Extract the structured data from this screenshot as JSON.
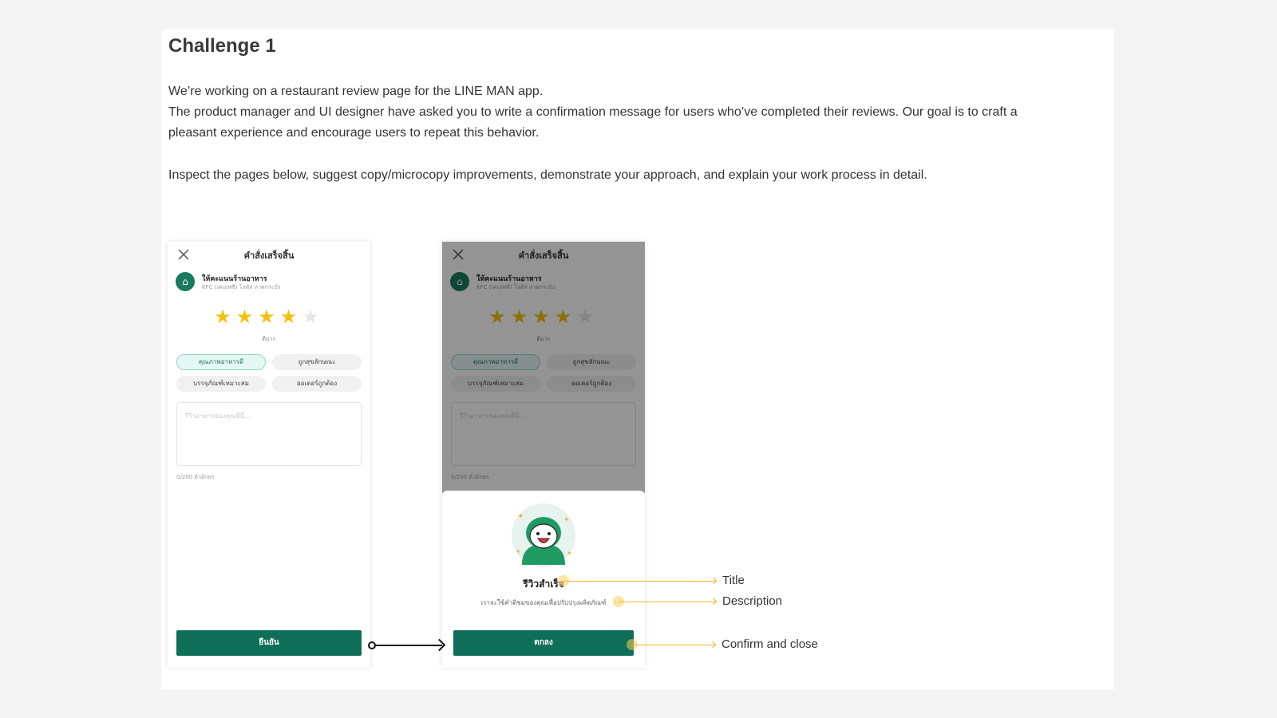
{
  "heading": "Challenge 1",
  "paragraphs": [
    "We’re working on a restaurant review page for the LINE MAN app.",
    "The product manager and UI designer have asked you to write a confirmation message for users who’ve completed their reviews. Our goal is to craft a pleasant experience and encourage users to repeat this behavior.",
    "Inspect the pages below, suggest copy/microcopy improvements, demonstrate your approach, and explain your work process in detail."
  ],
  "review_screen": {
    "header": "คำสั่งเสร็จสิ้น",
    "store_name": "ให้คะแนนร้านอาหาร",
    "store_sub": "KFC (เคเอฟซี) โลตัส ลาดกระบัง",
    "rating": 4,
    "rating_max": 5,
    "rating_label": "ดีมาก",
    "chips": [
      "คุณภาพอาหารดี",
      "ถูกสุขลักษณะ",
      "บรรจุภัณฑ์เหมาะสม",
      "ออเดอร์ถูกต้อง"
    ],
    "textarea_placeholder": "รีวิวอาหารของคุณที่นี่...",
    "char_count": "0/200 ตัวอักษร",
    "confirm_button": "ยืนยัน"
  },
  "success_sheet": {
    "title": "รีวิวสำเร็จ",
    "description": "เราจะใช้คำติชมของคุณเพื่อปรับปรุงผลิตภัณฑ์",
    "ok_button": "ตกลง"
  },
  "annotations": {
    "title": "Title",
    "description": "Description",
    "confirm": "Confirm and close"
  },
  "colors": {
    "brand_green": "#0e6e58",
    "star": "#f3c20d",
    "annotation": "#f0b429"
  }
}
